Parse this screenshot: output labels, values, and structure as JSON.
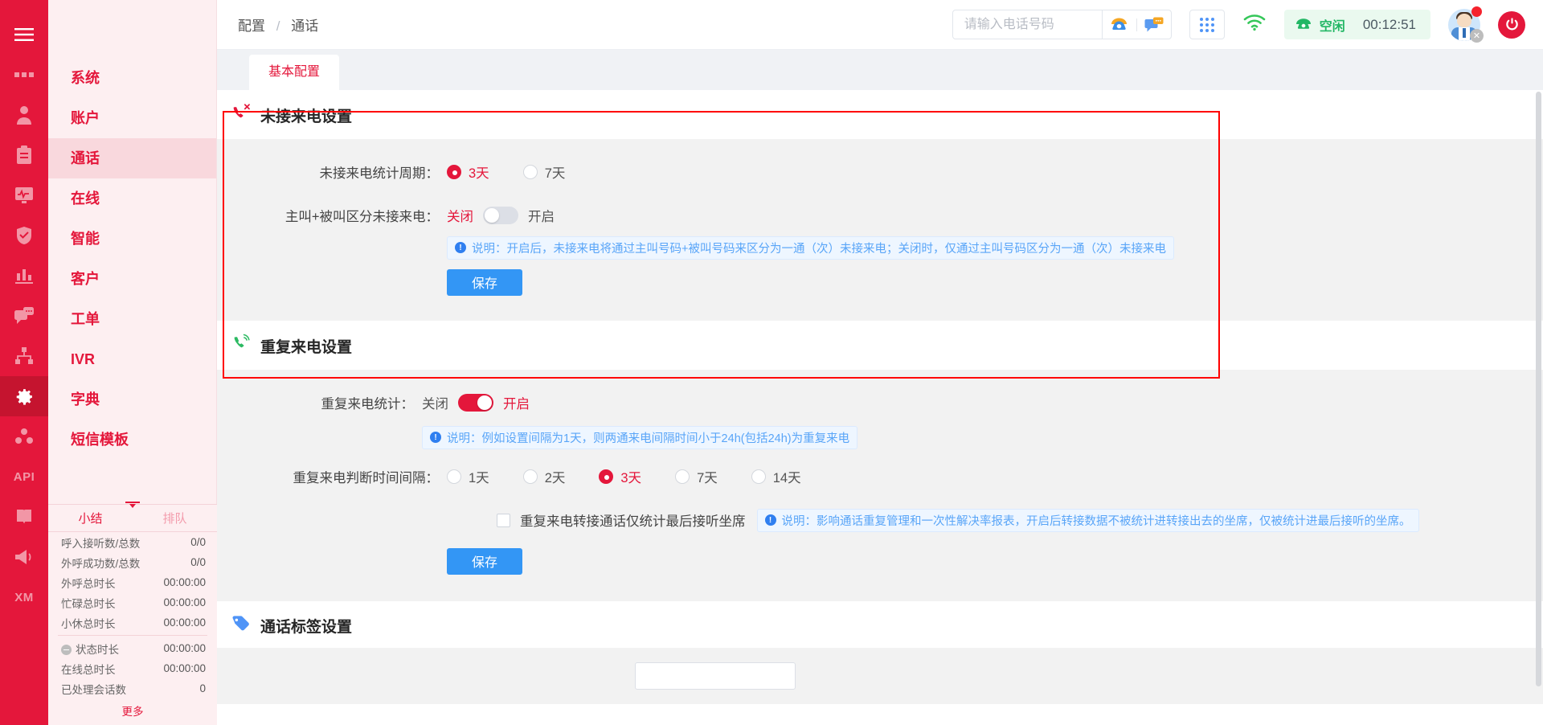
{
  "rail": {
    "items": [
      {
        "name": "menu-toggle-icon",
        "icon": "hamburger-icon"
      },
      {
        "name": "dashboard-icon",
        "icon": "dashboard-icon"
      },
      {
        "name": "agent-icon",
        "icon": "user-icon"
      },
      {
        "name": "tasks-icon",
        "icon": "clipboard-icon"
      },
      {
        "name": "monitor-icon",
        "icon": "monitor-icon"
      },
      {
        "name": "quality-icon",
        "icon": "shield-check-icon"
      },
      {
        "name": "report-icon",
        "icon": "bar-chart-icon"
      },
      {
        "name": "chat-icon",
        "icon": "chat-bubbles-icon"
      },
      {
        "name": "org-icon",
        "icon": "sitemap-icon"
      },
      {
        "name": "settings-icon",
        "icon": "gear-icon"
      },
      {
        "name": "groups-icon",
        "icon": "molecule-icon"
      },
      {
        "name": "api-icon",
        "icon": "api-text"
      },
      {
        "name": "docs-icon",
        "icon": "book-icon"
      },
      {
        "name": "broadcast-icon",
        "icon": "megaphone-icon"
      },
      {
        "name": "xm-icon",
        "icon": "xm-text"
      }
    ],
    "api_label": "API",
    "xm_label": "XM"
  },
  "submenu": {
    "items": [
      {
        "label": "系统",
        "selected": false,
        "dim": false
      },
      {
        "label": "账户",
        "selected": false,
        "dim": false
      },
      {
        "label": "通话",
        "selected": true,
        "dim": false
      },
      {
        "label": "在线",
        "selected": false,
        "dim": false
      },
      {
        "label": "智能",
        "selected": false,
        "dim": false
      },
      {
        "label": "客户",
        "selected": false,
        "dim": false
      },
      {
        "label": "工单",
        "selected": false,
        "dim": false
      },
      {
        "label": "IVR",
        "selected": false,
        "dim": false
      },
      {
        "label": "字典",
        "selected": false,
        "dim": false
      },
      {
        "label": "短信模板",
        "selected": false,
        "dim": false
      }
    ]
  },
  "stats": {
    "tabs": [
      {
        "label": "小结",
        "active": true
      },
      {
        "label": "排队",
        "active": false
      }
    ],
    "rows_top": [
      {
        "label": "呼入接听数/总数",
        "value": "0/0"
      },
      {
        "label": "外呼成功数/总数",
        "value": "0/0"
      },
      {
        "label": "外呼总时长",
        "value": "00:00:00"
      },
      {
        "label": "忙碌总时长",
        "value": "00:00:00"
      },
      {
        "label": "小休总时长",
        "value": "00:00:00"
      }
    ],
    "rows_bottom": [
      {
        "label": "状态时长",
        "value": "00:00:00",
        "has_dot": true
      },
      {
        "label": "在线总时长",
        "value": "00:00:00",
        "has_dot": false
      },
      {
        "label": "已处理会话数",
        "value": "0",
        "has_dot": false
      }
    ],
    "more_label": "更多"
  },
  "topbar": {
    "breadcrumb_root": "配置",
    "breadcrumb_sep": "/",
    "breadcrumb_current": "通话",
    "dial": {
      "placeholder": "请输入电话号码",
      "value": "",
      "call_icon": "telephone-icon",
      "sms_icon": "message-icon"
    },
    "keypad_icon": "keypad-grid-icon",
    "network_icon": "wifi-icon",
    "status": {
      "icon": "phone-idle-icon",
      "label": "空闲",
      "timer": "00:12:51"
    },
    "avatar_name": "agent-avatar",
    "power_icon": "power-icon"
  },
  "tabs": [
    {
      "label": "基本配置",
      "active": true
    }
  ],
  "panels": {
    "missed": {
      "icon": "missed-call-icon",
      "title": "未接来电设置",
      "period": {
        "label": "未接来电统计周期：",
        "options": [
          {
            "label": "3天",
            "selected": true
          },
          {
            "label": "7天",
            "selected": false
          }
        ]
      },
      "distinguish": {
        "label": "主叫+被叫区分未接来电：",
        "off_label": "关闭",
        "on_label": "开启",
        "enabled": false
      },
      "hint": "说明：开启后，未接来电将通过主叫号码+被叫号码来区分为一通（次）未接来电；关闭时，仅通过主叫号码区分为一通（次）未接来电",
      "save_label": "保存"
    },
    "repeat": {
      "icon": "repeat-call-icon",
      "title": "重复来电设置",
      "stat": {
        "label": "重复来电统计：",
        "off_label": "关闭",
        "on_label": "开启",
        "enabled": true
      },
      "hint1": "说明：例如设置间隔为1天，则两通来电间隔时间小于24h(包括24h)为重复来电",
      "interval": {
        "label": "重复来电判断时间间隔：",
        "options": [
          {
            "label": "1天",
            "selected": false
          },
          {
            "label": "2天",
            "selected": false
          },
          {
            "label": "3天",
            "selected": true
          },
          {
            "label": "7天",
            "selected": false
          },
          {
            "label": "14天",
            "selected": false
          }
        ]
      },
      "transfer_checkbox": {
        "label": "重复来电转接通话仅统计最后接听坐席",
        "checked": false
      },
      "hint2": "说明：影响通话重复管理和一次性解决率报表，开启后转接数据不被统计进转接出去的坐席，仅被统计进最后接听的坐席。",
      "save_label": "保存"
    },
    "tags": {
      "icon": "tag-icon",
      "title": "通话标签设置"
    }
  },
  "colors": {
    "brand_red": "#e4173b",
    "highlight_border": "#ff0000",
    "accent_blue": "#3396f5",
    "status_green": "#23b765"
  }
}
